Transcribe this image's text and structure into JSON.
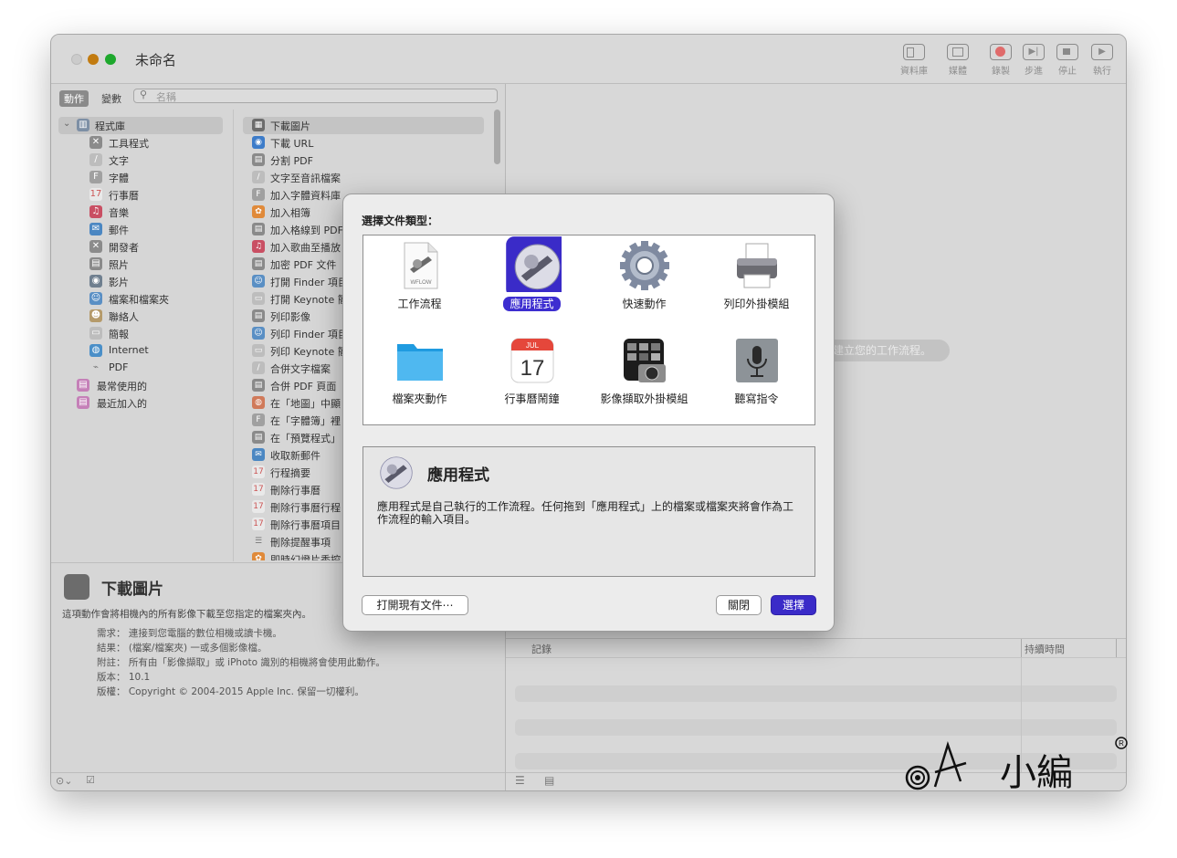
{
  "window": {
    "title": "未命名"
  },
  "toolbar": {
    "library": "資料庫",
    "media": "媒體",
    "record": "錄製",
    "step": "步進",
    "stop": "停止",
    "run": "執行"
  },
  "tabs": {
    "actions": "動作",
    "variables": "變數"
  },
  "search": {
    "placeholder": "名稱"
  },
  "library": {
    "root": "程式庫",
    "items": [
      "工具程式",
      "文字",
      "字體",
      "行事曆",
      "音樂",
      "郵件",
      "開發者",
      "照片",
      "影片",
      "檔案和檔案夾",
      "聯絡人",
      "簡報",
      "Internet",
      "PDF"
    ],
    "most_used": "最常使用的",
    "recently_added": "最近加入的"
  },
  "actions": {
    "items": [
      "下載圖片",
      "下載 URL",
      "分割 PDF",
      "文字至音訊檔案",
      "加入字體資料庫",
      "加入相簿",
      "加入格線到 PDF",
      "加入歌曲至播放",
      "加密 PDF 文件",
      "打開 Finder 項目",
      "打開 Keynote 簡",
      "列印影像",
      "列印 Finder 項目",
      "列印 Keynote 簡",
      "合併文字檔案",
      "合併 PDF 頁面",
      "在「地圖」中顯",
      "在「字體簿」裡",
      "在「預覽程式」",
      "收取新郵件",
      "行程摘要",
      "刪除行事曆",
      "刪除行事曆行程",
      "刪除行事曆項目",
      "刪除提醒事項",
      "即時幻燈片秀控"
    ]
  },
  "description": {
    "title": "下載圖片",
    "text": "這項動作會將相機內的所有影像下載至您指定的檔案夾內。",
    "requires": "需求： 連接到您電腦的數位相機或讀卡機。",
    "result": "結果： (檔案/檔案夾) 一或多個影像檔。",
    "note": "附註： 所有由「影像擷取」或 iPhoto 識別的相機將會使用此動作。",
    "version": "版本： 10.1",
    "copyright": "版權： Copyright © 2004-2015 Apple Inc. 保留一切權利。"
  },
  "canvas": {
    "hint": "建立您的工作流程。"
  },
  "log": {
    "col_log": "記錄",
    "col_duration": "持續時間"
  },
  "dialog": {
    "prompt": "選擇文件類型：",
    "types": [
      {
        "label": "工作流程",
        "icon": "workflow-icon"
      },
      {
        "label": "應用程式",
        "icon": "application-icon"
      },
      {
        "label": "快速動作",
        "icon": "gear-icon"
      },
      {
        "label": "列印外掛模組",
        "icon": "printer-icon"
      },
      {
        "label": "檔案夾動作",
        "icon": "folder-icon"
      },
      {
        "label": "行事曆鬧鐘",
        "icon": "calendar-icon"
      },
      {
        "label": "影像擷取外掛模組",
        "icon": "image-capture-icon"
      },
      {
        "label": "聽寫指令",
        "icon": "microphone-icon"
      }
    ],
    "calendar_month": "JUL",
    "calendar_day": "17",
    "workflow_badge": "WFLOW",
    "selected_title": "應用程式",
    "selected_desc": "應用程式是自己執行的工作流程。任何拖到「應用程式」上的檔案或檔案夾將會作為工作流程的輸入項目。",
    "open_existing": "打開現有文件⋯",
    "close": "關閉",
    "choose": "選擇"
  },
  "watermark": {
    "text": "小編"
  },
  "colors": {
    "accent": "#3a2bc8",
    "traffic_yellow": "#c27b10",
    "traffic_green": "#1ea82d"
  }
}
